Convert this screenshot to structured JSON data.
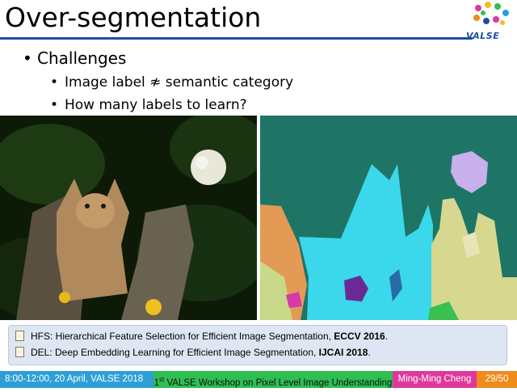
{
  "slide": {
    "title": "Over-segmentation",
    "logo_text": "VALSE"
  },
  "bullets": {
    "level1": "Challenges",
    "level2": [
      "Image label ≉ semantic category",
      "How many labels to learn?"
    ]
  },
  "references": [
    {
      "text": "HFS: Hierarchical Feature Selection for Efficient Image Segmentation, ",
      "venue": "ECCV 2016",
      "end": "."
    },
    {
      "text": "DEL: Deep Embedding Learning for Efficient Image Segmentation, ",
      "venue": "IJCAI 2018",
      "end": "."
    }
  ],
  "footer": {
    "time": "8:00-12:00, 20 April, VALSE 2018",
    "workshop_prefix": "1",
    "workshop_sup": "st",
    "workshop_rest": " VALSE Workshop on Pixel Level Image Understanding",
    "speaker": "Ming-Ming Cheng",
    "page": "29/50"
  },
  "colors": {
    "rule": "#1f4e9e",
    "footer_blue": "#2e9fd6",
    "footer_green": "#2fbe52",
    "footer_pink": "#e0389a",
    "footer_orange": "#f08a1a",
    "seg_background": "#1e7566",
    "seg_cat": "#3ad8ea",
    "seg_stump": "#d6d890"
  }
}
